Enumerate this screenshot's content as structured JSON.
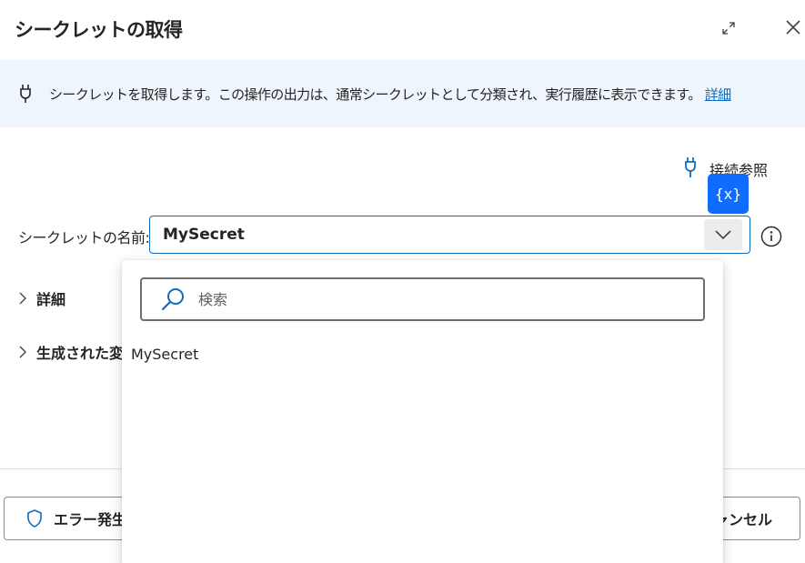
{
  "header": {
    "title": "シークレットの取得"
  },
  "banner": {
    "text": "シークレットを取得します。この操作の出力は、通常シークレットとして分類され、実行履歴に表示できます。",
    "link": "詳細"
  },
  "connection": {
    "label": "接続参照"
  },
  "variable_badge": {
    "text": "{x}"
  },
  "field": {
    "label": "シークレットの名前:",
    "value": "MySecret"
  },
  "sections": [
    {
      "label": "詳細"
    },
    {
      "label": "生成された変"
    }
  ],
  "footer": {
    "error_button": "エラー発生",
    "cancel_button": "ャンセル"
  },
  "dropdown": {
    "search_placeholder": "検索",
    "options": [
      "MySecret"
    ]
  },
  "colors": {
    "accent": "#0f6cbd",
    "badge": "#0f6cfd",
    "banner_bg": "#eff5fc"
  }
}
